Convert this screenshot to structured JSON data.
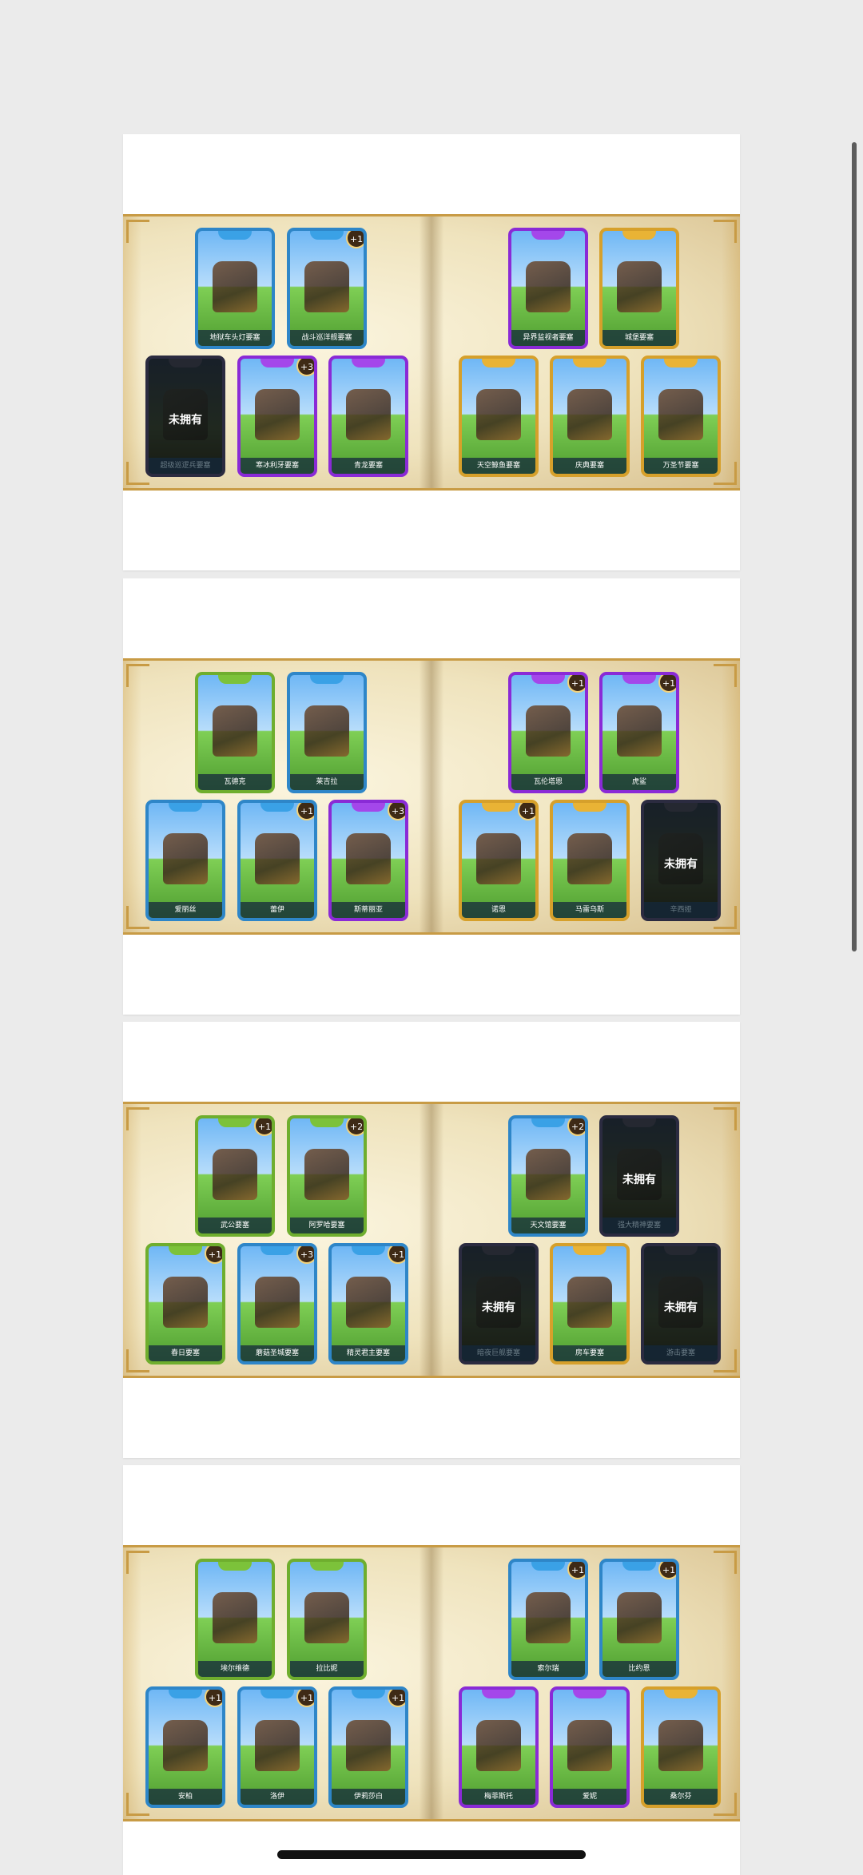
{
  "pages": [
    {
      "cards": [
        {
          "name": "地狱车头灯要塞",
          "color": "blue",
          "owned": true,
          "count": ""
        },
        {
          "name": "战斗巡洋舰要塞",
          "color": "blue",
          "owned": true,
          "count": "+1"
        },
        {
          "name": "超级巡逻兵要塞",
          "color": "blue",
          "owned": false,
          "count": ""
        },
        {
          "name": "寒冰利牙要塞",
          "color": "purple",
          "owned": true,
          "count": "+3"
        },
        {
          "name": "青龙要塞",
          "color": "purple",
          "owned": true,
          "count": ""
        },
        {
          "name": "异界监视者要塞",
          "color": "purple",
          "owned": true,
          "count": ""
        },
        {
          "name": "城堡要塞",
          "color": "gold",
          "owned": true,
          "count": ""
        },
        {
          "name": "天空鲸鱼要塞",
          "color": "gold",
          "owned": true,
          "count": ""
        },
        {
          "name": "庆典要塞",
          "color": "gold",
          "owned": true,
          "count": ""
        },
        {
          "name": "万圣节要塞",
          "color": "gold",
          "owned": true,
          "count": ""
        }
      ]
    },
    {
      "cards": [
        {
          "name": "瓦德克",
          "color": "green",
          "owned": true,
          "count": ""
        },
        {
          "name": "莱吉拉",
          "color": "blue",
          "owned": true,
          "count": ""
        },
        {
          "name": "爱丽丝",
          "color": "blue",
          "owned": true,
          "count": ""
        },
        {
          "name": "蕾伊",
          "color": "blue",
          "owned": true,
          "count": "+1"
        },
        {
          "name": "斯蒂丽亚",
          "color": "purple",
          "owned": true,
          "count": "+3"
        },
        {
          "name": "瓦伦塔恩",
          "color": "purple",
          "owned": true,
          "count": "+1"
        },
        {
          "name": "虎鲨",
          "color": "purple",
          "owned": true,
          "count": "+1"
        },
        {
          "name": "诺恩",
          "color": "gold",
          "owned": true,
          "count": "+1"
        },
        {
          "name": "马雷乌斯",
          "color": "gold",
          "owned": true,
          "count": ""
        },
        {
          "name": "辛西娅",
          "color": "gold",
          "owned": false,
          "count": ""
        }
      ]
    },
    {
      "cards": [
        {
          "name": "武公要塞",
          "color": "green",
          "owned": true,
          "count": "+1"
        },
        {
          "name": "阿罗哈要塞",
          "color": "green",
          "owned": true,
          "count": "+2"
        },
        {
          "name": "春日要塞",
          "color": "green",
          "owned": true,
          "count": "+1"
        },
        {
          "name": "蘑菇圣城要塞",
          "color": "blue",
          "owned": true,
          "count": "+3"
        },
        {
          "name": "精灵君主要塞",
          "color": "blue",
          "owned": true,
          "count": "+1"
        },
        {
          "name": "天文馆要塞",
          "color": "blue",
          "owned": true,
          "count": "+2"
        },
        {
          "name": "强大精神要塞",
          "color": "purple",
          "owned": false,
          "count": ""
        },
        {
          "name": "暗夜巨舰要塞",
          "color": "purple",
          "owned": false,
          "count": ""
        },
        {
          "name": "房车要塞",
          "color": "gold",
          "owned": true,
          "count": ""
        },
        {
          "name": "游击要塞",
          "color": "gold",
          "owned": false,
          "count": ""
        }
      ]
    },
    {
      "cards": [
        {
          "name": "埃尔维德",
          "color": "green",
          "owned": true,
          "count": ""
        },
        {
          "name": "拉比妮",
          "color": "green",
          "owned": true,
          "count": ""
        },
        {
          "name": "安柏",
          "color": "blue",
          "owned": true,
          "count": "+1"
        },
        {
          "name": "洛伊",
          "color": "blue",
          "owned": true,
          "count": "+1"
        },
        {
          "name": "伊莉莎白",
          "color": "blue",
          "owned": true,
          "count": "+1"
        },
        {
          "name": "索尔瑞",
          "color": "blue",
          "owned": true,
          "count": "+1"
        },
        {
          "name": "比约恩",
          "color": "blue",
          "owned": true,
          "count": "+1"
        },
        {
          "name": "梅菲斯托",
          "color": "purple",
          "owned": true,
          "count": ""
        },
        {
          "name": "爱妮",
          "color": "purple",
          "owned": true,
          "count": ""
        },
        {
          "name": "桑尔芬",
          "color": "gold",
          "owned": true,
          "count": ""
        }
      ]
    }
  ],
  "locked_label": "未拥有"
}
